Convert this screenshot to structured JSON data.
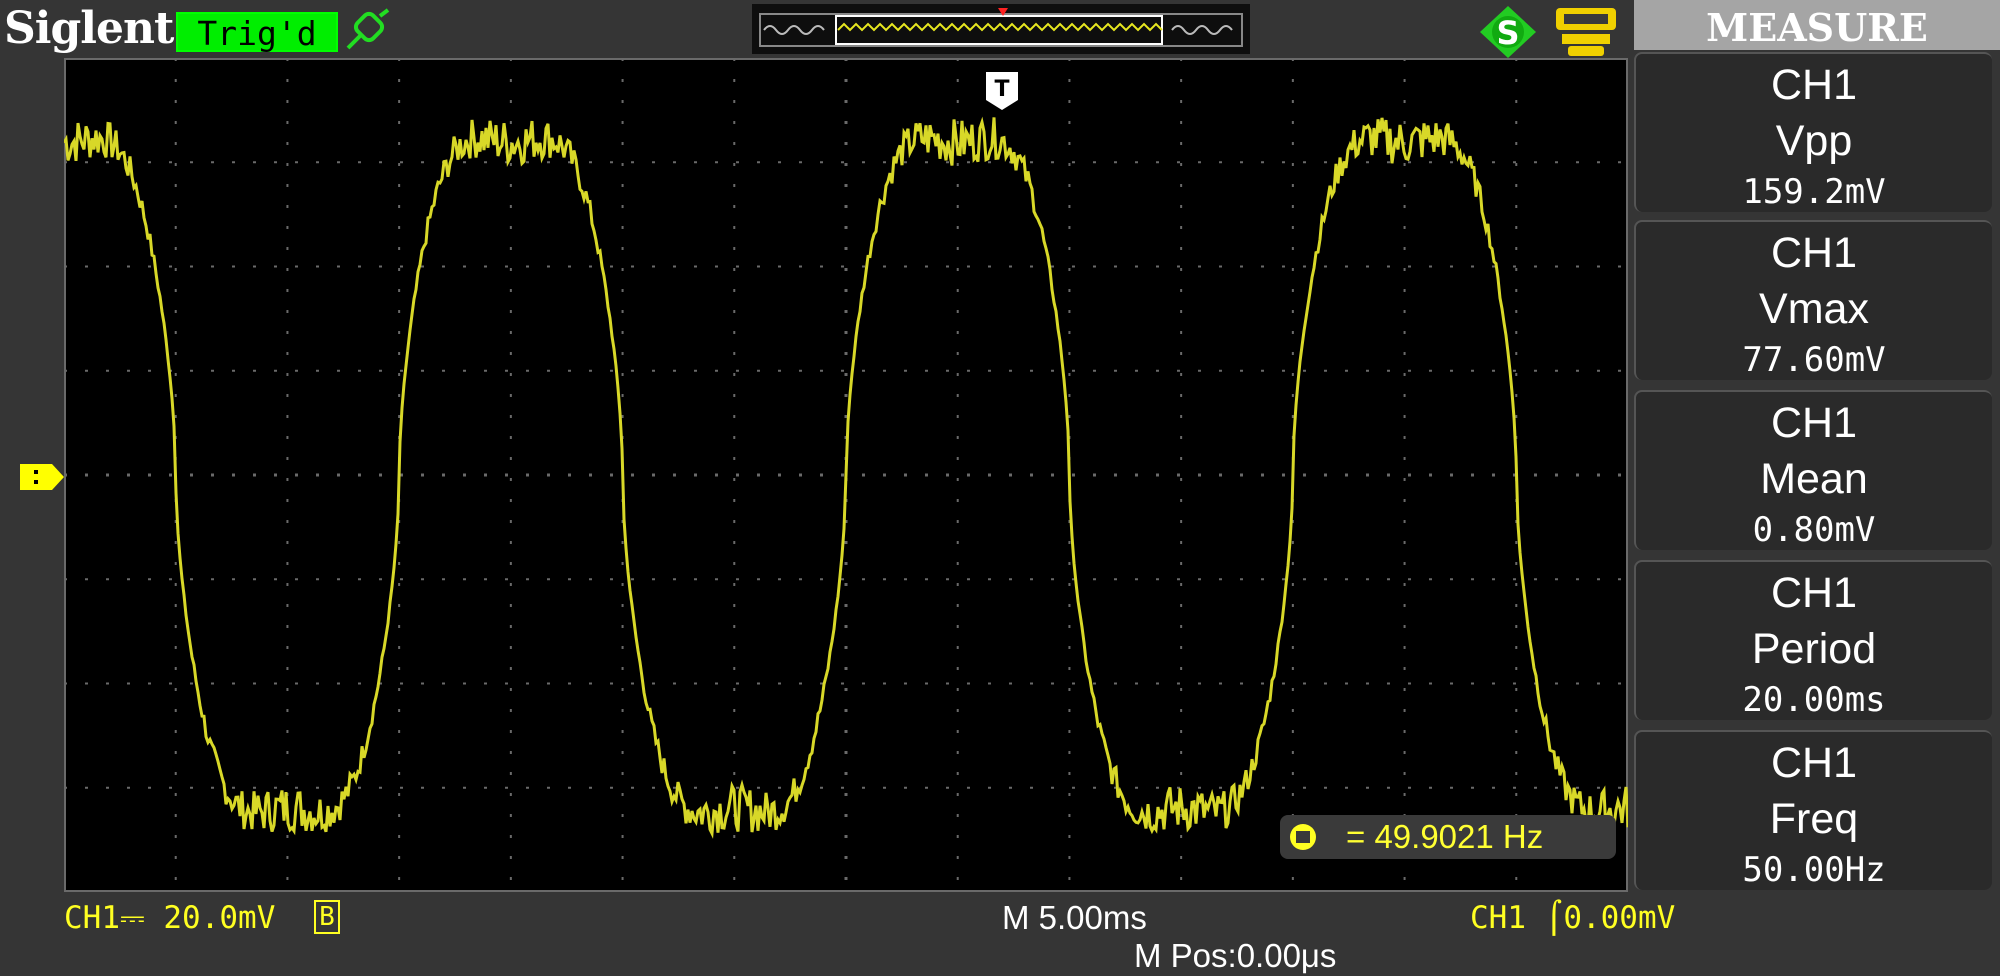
{
  "header": {
    "brand": "Siglent",
    "trigger_status": "Trig'd",
    "sidebar_title": "MEASURE"
  },
  "measurements": [
    {
      "channel": "CH1",
      "name": "Vpp",
      "value": "159.2mV"
    },
    {
      "channel": "CH1",
      "name": "Vmax",
      "value": "77.60mV"
    },
    {
      "channel": "CH1",
      "name": "Mean",
      "value": "0.80mV"
    },
    {
      "channel": "CH1",
      "name": "Period",
      "value": "20.00ms"
    },
    {
      "channel": "CH1",
      "name": "Freq",
      "value": "50.00Hz"
    }
  ],
  "freq_counter": {
    "value": "= 49.9021 Hz"
  },
  "bottom": {
    "ch1_scale": "CH1⎓ 20.0mV",
    "bw_limit": "B",
    "timebase": "M 5.00ms",
    "trigger": "CH1 ⌠0.00mV",
    "horizontal_position": "M Pos:0.00μs"
  },
  "colors": {
    "trace": "#d8d828",
    "grid": "#6a6a6a",
    "screen_bg": "#000000",
    "trig_badge": "#00ee00"
  },
  "icons": {
    "trigger_icon": "green-probe-icon",
    "status_s": "green-s-badge-icon",
    "status_disk": "yellow-storage-icon",
    "channel_marker": "yellow-ch1-ground-marker-icon",
    "trigger_marker": "trigger-position-T-icon"
  }
}
